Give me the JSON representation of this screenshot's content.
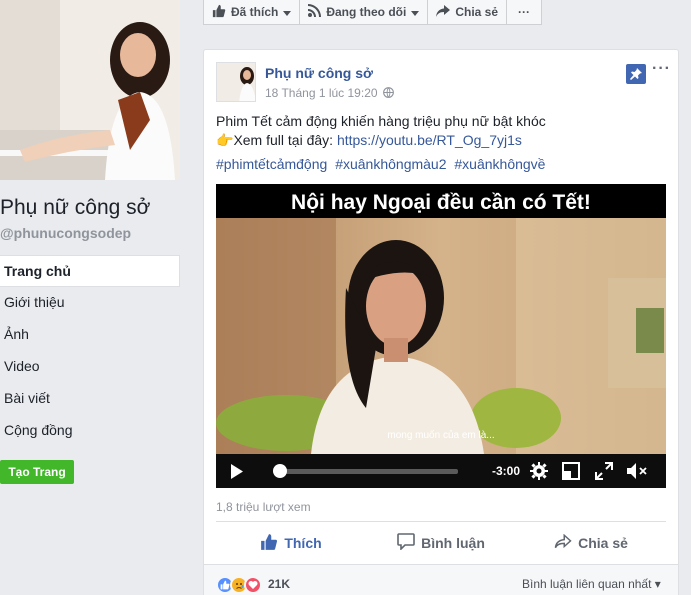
{
  "left": {
    "page_name": "Phụ nữ công sở",
    "page_handle": "@phunucongsodep",
    "nav": [
      {
        "label": "Trang chủ",
        "active": true
      },
      {
        "label": "Giới thiệu",
        "active": false
      },
      {
        "label": "Ảnh",
        "active": false
      },
      {
        "label": "Video",
        "active": false
      },
      {
        "label": "Bài viết",
        "active": false
      },
      {
        "label": "Cộng đồng",
        "active": false
      }
    ],
    "create_page_label": "Tạo Trang"
  },
  "topbar": {
    "liked_label": "Đã thích",
    "following_label": "Đang theo dõi",
    "share_label": "Chia sẻ",
    "more_label": "···"
  },
  "post": {
    "author": "Phụ nữ công sở",
    "timestamp": "18 Tháng 1 lúc 19:20",
    "audience_icon": "globe-icon",
    "text_line1": "Phim Tết cảm động khiến hàng triệu phụ nữ bật khóc",
    "text_line2_emoji": "👉",
    "text_line2_prefix": "Xem full tại đây: ",
    "text_link": "https://youtu.be/RT_Og_7yj1s",
    "hashtags": [
      "#phimtếtcảmđộng",
      "#xuânkhôngmàu2",
      "#xuânkhôngvề"
    ],
    "more_label": "···"
  },
  "video": {
    "title": "Nội hay Ngoại đều cần có Tết!",
    "subtitle": "mong muốn của em là...",
    "time_remaining": "-3:00",
    "progress": 0.03
  },
  "stats": {
    "views": "1,8 triệu lượt xem"
  },
  "actions": {
    "like_label": "Thích",
    "comment_label": "Bình luận",
    "share_label": "Chia sẻ"
  },
  "reactions": {
    "count": "21K",
    "filter_label": "Bình luận liên quan nhất ▾",
    "types": [
      "like-icon",
      "sad-icon",
      "love-icon"
    ]
  },
  "colors": {
    "brand_blue": "#4267b2",
    "link": "#365899",
    "green": "#42b72a",
    "background": "#e9ebee"
  }
}
